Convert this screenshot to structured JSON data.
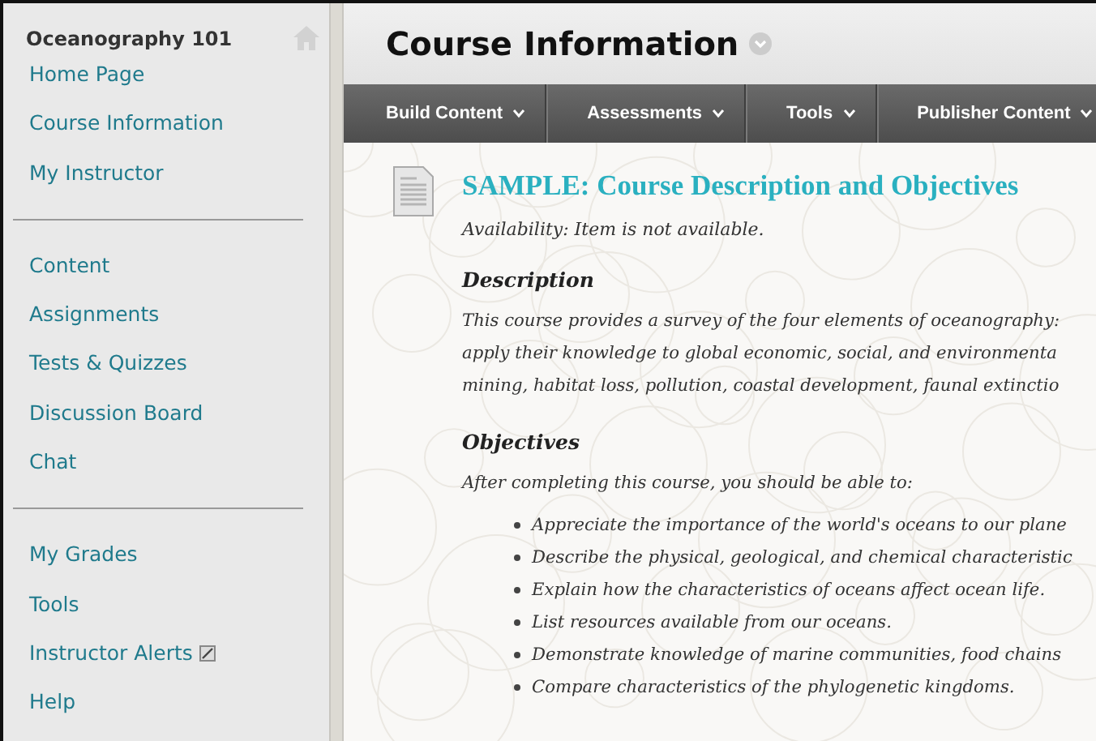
{
  "sidebar": {
    "course_title": "Oceanography 101",
    "groups": [
      {
        "items": [
          {
            "label": "Home Page"
          },
          {
            "label": "Course Information"
          },
          {
            "label": "My Instructor"
          }
        ]
      },
      {
        "items": [
          {
            "label": "Content"
          },
          {
            "label": "Assignments"
          },
          {
            "label": "Tests & Quizzes"
          },
          {
            "label": "Discussion Board"
          },
          {
            "label": "Chat"
          }
        ]
      },
      {
        "items": [
          {
            "label": "My Grades"
          },
          {
            "label": "Tools"
          },
          {
            "label": "Instructor Alerts",
            "kind": "external"
          },
          {
            "label": "Help"
          }
        ]
      }
    ]
  },
  "page_title": "Course Information",
  "action_bar": [
    {
      "label": "Build Content"
    },
    {
      "label": "Assessments"
    },
    {
      "label": "Tools"
    },
    {
      "label": "Publisher Content"
    }
  ],
  "item": {
    "title": "SAMPLE: Course Description and Objectives",
    "availability": "Availability:  Item is not available.",
    "sections": [
      {
        "heading": "Description",
        "lines": [
          "This course provides a survey of the four elements of oceanography:",
          "apply their knowledge to global economic, social, and environmenta",
          "mining, habitat loss, pollution, coastal development, faunal extinctio"
        ]
      },
      {
        "heading": "Objectives",
        "lines": [
          "After completing this course, you should be able to:"
        ],
        "bullets": [
          "Appreciate the importance of the world's oceans to our plane",
          "Describe the physical, geological, and chemical characteristic",
          "Explain how the characteristics of oceans affect ocean life.",
          "List resources available from our oceans.",
          "Demonstrate knowledge of marine communities, food chains",
          "Compare characteristics of the phylogenetic kingdoms."
        ]
      }
    ]
  }
}
